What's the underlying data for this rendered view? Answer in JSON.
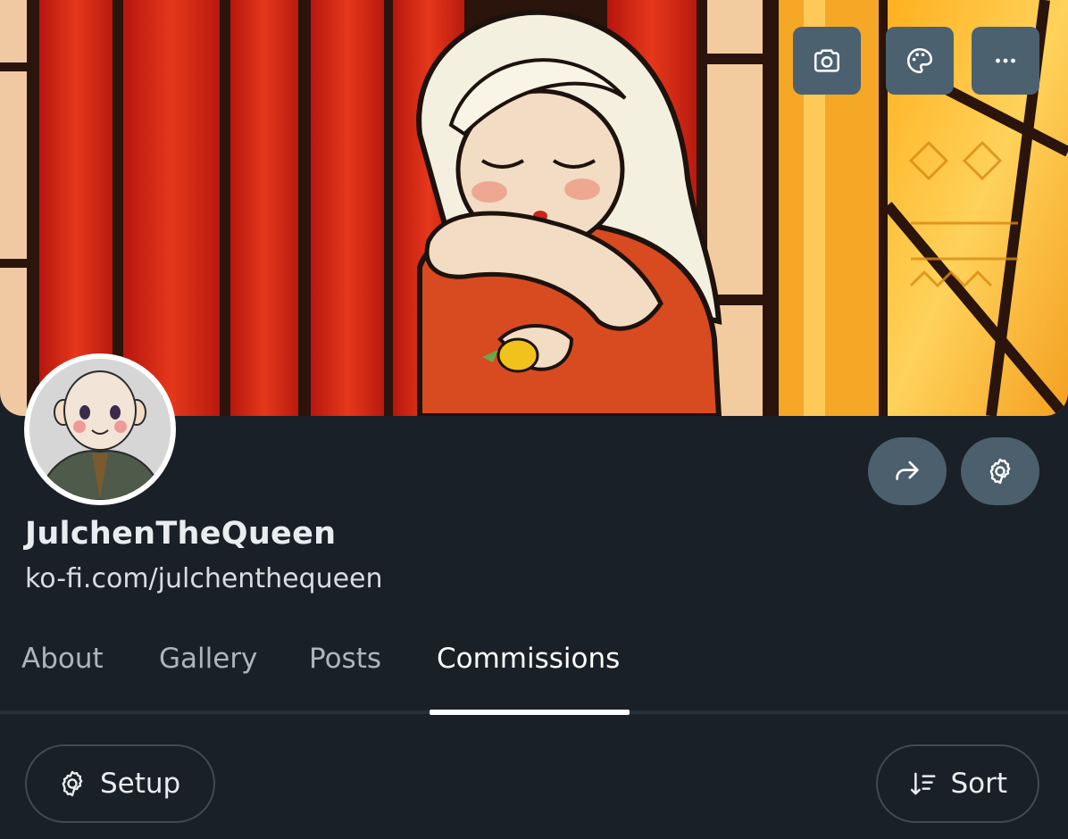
{
  "cover_actions": {
    "icons": [
      "camera-icon",
      "palette-icon",
      "more-horizontal-icon"
    ]
  },
  "profile": {
    "name": "JulchenTheQueen",
    "url": "ko-fi.com/julchenthequeen"
  },
  "profile_actions": {
    "icons": [
      "share-icon",
      "settings-gear-icon"
    ]
  },
  "tabs": [
    {
      "label": "About",
      "active": false
    },
    {
      "label": "Gallery",
      "active": false
    },
    {
      "label": "Posts",
      "active": false
    },
    {
      "label": "Commissions",
      "active": true
    }
  ],
  "toolbar": {
    "setup_label": "Setup",
    "sort_label": "Sort"
  },
  "colors": {
    "background": "#1a2027",
    "button": "#4c6170",
    "tab_inactive": "#aab6bf",
    "tab_active": "#ffffff"
  }
}
